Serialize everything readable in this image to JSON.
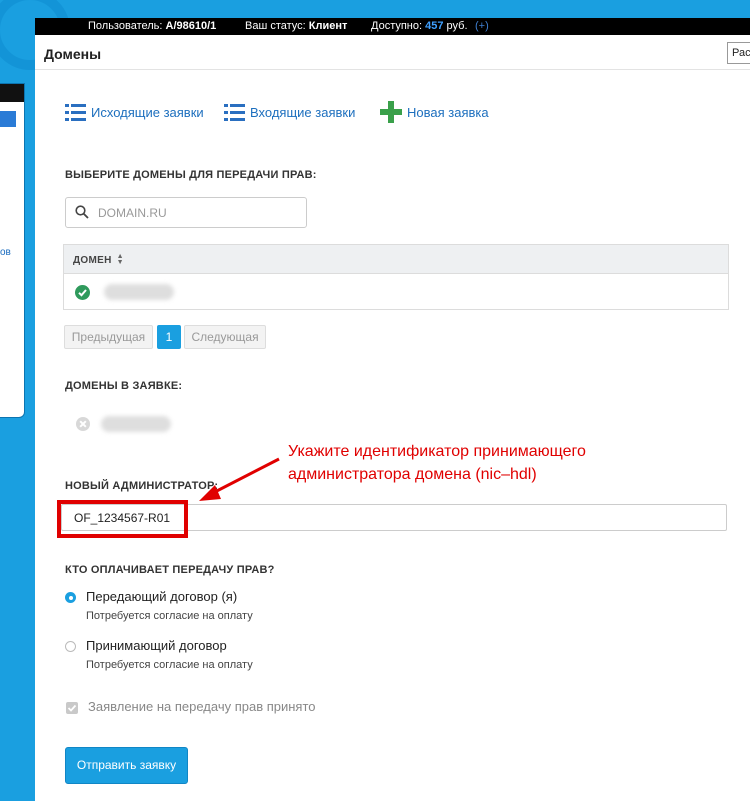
{
  "topbar": {
    "user_label": "Пользователь:",
    "user_value": "A/98610/1",
    "status_label": "Ваш статус:",
    "status_value": "Клиент",
    "balance_label": "Доступно:",
    "balance_value": "457",
    "balance_unit": "руб.",
    "topup": "(+)"
  },
  "header": {
    "title": "Домены",
    "right_button": "Рас"
  },
  "nav": {
    "outgoing": "Исходящие заявки",
    "incoming": "Входящие заявки",
    "new_request": "Новая заявка"
  },
  "select_section": {
    "label": "ВЫБЕРИТЕ ДОМЕНЫ ДЛЯ ПЕРЕДАЧИ ПРАВ:",
    "search_placeholder": "DOMAIN.RU",
    "column_header": "ДОМЕН"
  },
  "pagination": {
    "prev": "Предыдущая",
    "page": "1",
    "next": "Следующая"
  },
  "request_section": {
    "label": "ДОМЕНЫ В ЗАЯВКЕ:"
  },
  "admin_section": {
    "label": "НОВЫЙ АДМИНИСТРАТОР:",
    "value": "OF_1234567-R01",
    "annotation_line1": "Укажите идентификатор принимающего",
    "annotation_line2": "администратора домена (nic–hdl)"
  },
  "payment_section": {
    "label": "КТО ОПЛАЧИВАЕТ ПЕРЕДАЧУ ПРАВ?",
    "options": [
      {
        "label": "Передающий договор (я)",
        "note": "Потребуется согласие на оплату",
        "selected": true
      },
      {
        "label": "Принимающий договор",
        "note": "Потребуется согласие на оплату",
        "selected": false
      }
    ]
  },
  "statement": {
    "label": "Заявление на передачу прав принято",
    "checked": true
  },
  "submit": {
    "label": "Отправить заявку"
  },
  "colors": {
    "accent": "#1a9fe0",
    "link": "#1d6fbe",
    "annotation": "#e00000",
    "success": "#2f9a5c"
  }
}
